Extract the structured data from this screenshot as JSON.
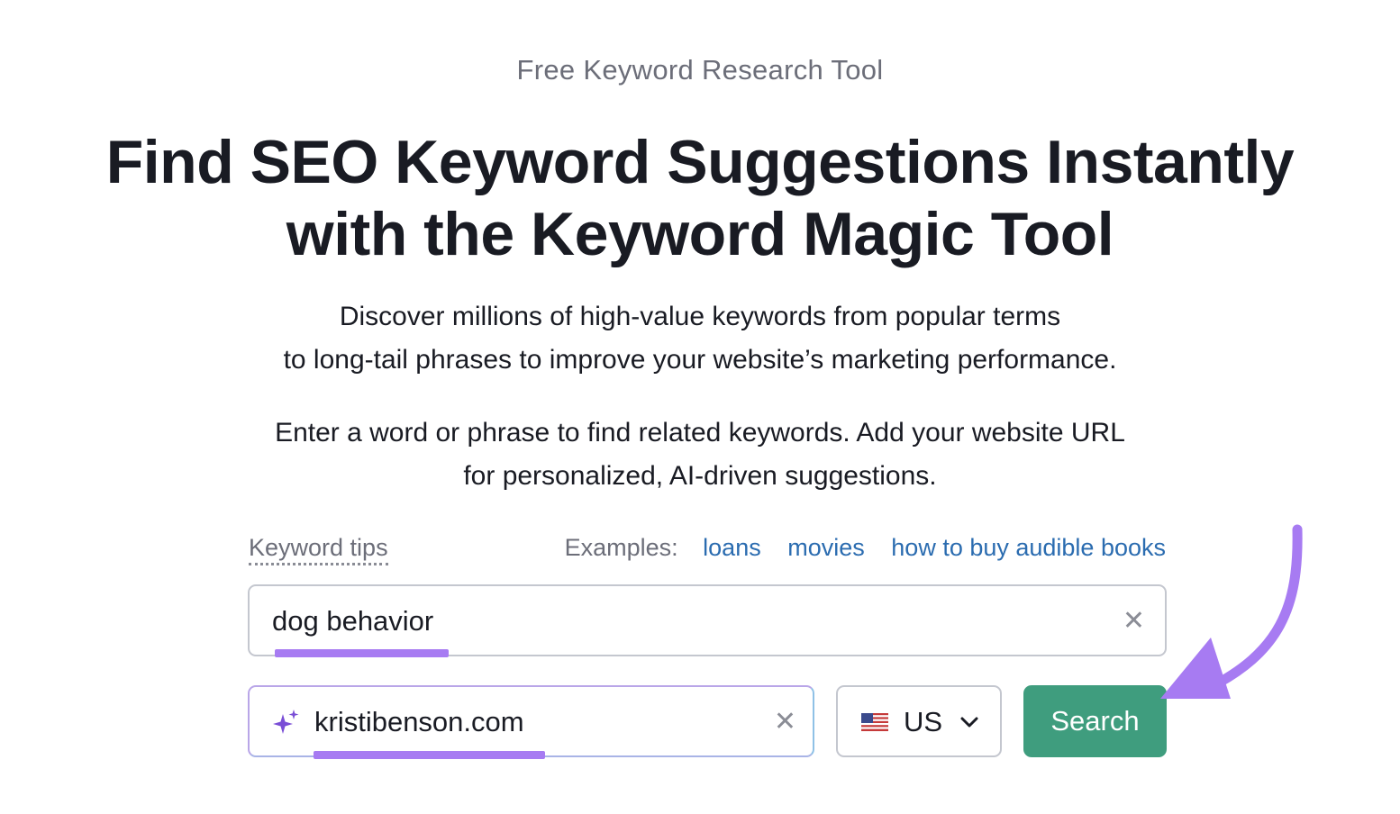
{
  "eyebrow": "Free Keyword Research Tool",
  "headline": {
    "line1": "Find SEO Keyword Suggestions Instantly",
    "line2": "with the Keyword Magic Tool"
  },
  "intro": {
    "line1": "Discover millions of high-value keywords from popular terms",
    "line2": "to long-tail phrases to improve your website’s marketing performance."
  },
  "instructions": {
    "line1": "Enter a word or phrase to find related keywords. Add your website URL",
    "line2": "for personalized, AI-driven suggestions."
  },
  "keyword_tips": "Keyword tips",
  "examples": {
    "label": "Examples:",
    "items": [
      "loans",
      "movies",
      "how to buy audible books"
    ]
  },
  "keyword_input": {
    "value": "dog behavior",
    "clear_icon": "close-icon"
  },
  "url_input": {
    "value": "kristibenson.com",
    "leading_icon": "sparkle-icon",
    "clear_icon": "close-icon"
  },
  "country_select": {
    "value": "US",
    "flag_icon": "us-flag-icon",
    "chevron_icon": "chevron-down-icon"
  },
  "search_button": "Search",
  "colors": {
    "accent_purple": "#a77bf2",
    "search_green": "#3f9d7e",
    "link_blue": "#2b6cb0",
    "heading": "#191b23",
    "muted": "#6c6e79"
  }
}
